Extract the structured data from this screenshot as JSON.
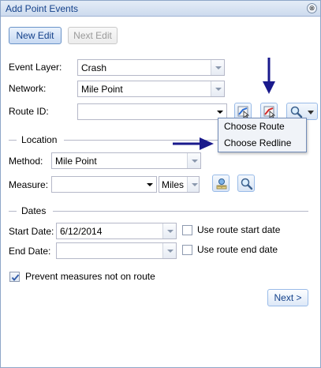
{
  "window": {
    "title": "Add Point Events",
    "close_glyph": "⊗"
  },
  "toolbar": {
    "new_edit_label": "New Edit",
    "next_edit_label": "Next Edit"
  },
  "form": {
    "event_layer": {
      "label": "Event Layer:",
      "value": "Crash"
    },
    "network": {
      "label": "Network:",
      "value": "Mile Point"
    },
    "route_id": {
      "label": "Route ID:",
      "value": ""
    }
  },
  "route_menu": {
    "items": [
      "Choose Route",
      "Choose Redline"
    ]
  },
  "location": {
    "legend": "Location",
    "method": {
      "label": "Method:",
      "value": "Mile Point"
    },
    "measure": {
      "label": "Measure:",
      "value": "",
      "units": "Miles"
    }
  },
  "dates": {
    "legend": "Dates",
    "start_date": {
      "label": "Start Date:",
      "value": "6/12/2014",
      "checkbox_label": "Use route start date",
      "checked": false
    },
    "end_date": {
      "label": "End Date:",
      "value": "",
      "checkbox_label": "Use route end date",
      "checked": false
    }
  },
  "prevent": {
    "label": "Prevent measures not on route",
    "checked": true
  },
  "footer": {
    "next_label": "Next >"
  },
  "icons": {
    "route_pick": "choose-route-icon",
    "redline_pick": "choose-redline-icon",
    "zoom": "zoom-magnifier-icon",
    "measure_pick": "measure-pick-icon",
    "measure_zoom": "measure-zoom-icon",
    "checkmark": "checkmark-icon"
  },
  "colors": {
    "accent": "#15428b",
    "annotation_arrow": "#1a1a8c",
    "border": "#99bbe8"
  }
}
